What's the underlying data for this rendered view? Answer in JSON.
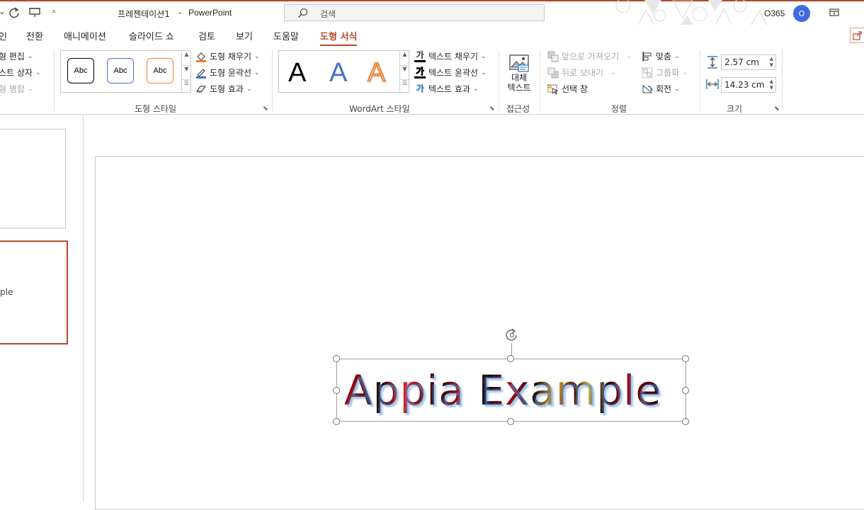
{
  "titlebar": {
    "document_title": "프레젠테이션1",
    "separator": "-",
    "app_name": "PowerPoint",
    "search_placeholder": "검색",
    "account_label": "O365",
    "avatar_initial": "O",
    "accent_color": "#b7472a"
  },
  "tabs": [
    {
      "label": "인"
    },
    {
      "label": "전환"
    },
    {
      "label": "애니메이션"
    },
    {
      "label": "슬라이드 쇼"
    },
    {
      "label": "검토"
    },
    {
      "label": "보기"
    },
    {
      "label": "도움말"
    },
    {
      "label": "도형 서식",
      "active": true
    }
  ],
  "ribbon": {
    "insert_shapes": {
      "edit_shape": "형 편집",
      "text_box": "스트 상자",
      "merge_shapes": "형 병합"
    },
    "shape_styles": {
      "group_label": "도형 스타일",
      "preset_label": "Abc",
      "fill": "도형 채우기",
      "outline": "도형 윤곽선",
      "effects": "도형 효과"
    },
    "wordart_styles": {
      "group_label": "WordArt 스타일",
      "preset_letter": "A",
      "text_fill": "텍스트 채우기",
      "text_outline": "텍스트 윤곽선",
      "text_effects": "텍스트 효과",
      "icon_glyph": "가"
    },
    "accessibility": {
      "group_label": "접근성",
      "alt_text_line1": "대체",
      "alt_text_line2": "텍스트"
    },
    "arrange": {
      "group_label": "정렬",
      "bring_forward": "앞으로 가져오기",
      "send_backward": "뒤로 보내기",
      "selection_pane": "선택 창",
      "align": "맞춤",
      "group": "그룹화",
      "rotate": "회전"
    },
    "size": {
      "group_label": "크기",
      "height": "2.57 cm",
      "width": "14.23 cm"
    }
  },
  "thumbnails": [
    {
      "text": ""
    },
    {
      "text": "ple",
      "selected": true
    }
  ],
  "slide": {
    "wordart_text": "Appia Example"
  }
}
